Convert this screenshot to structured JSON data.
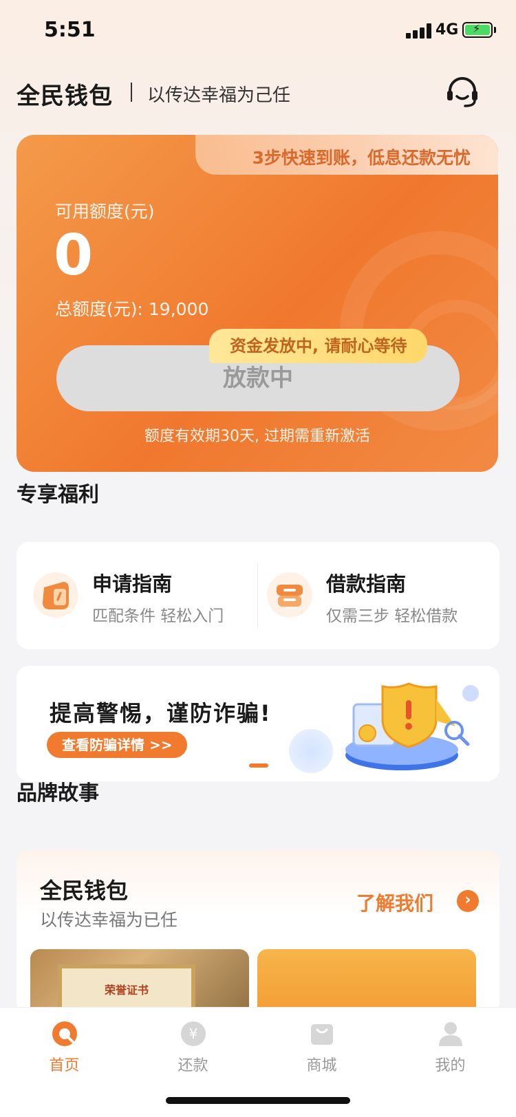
{
  "status_bar": {
    "time": "5:51",
    "network": "4G"
  },
  "header": {
    "brand": "全民钱包",
    "slogan": "以传达幸福为己任",
    "service_icon": "headset-icon"
  },
  "credit_card": {
    "banner_text": "3步快速到账，低息还款无忧",
    "available_label": "可用额度(元)",
    "available_value": "0",
    "total_line": "总额度(元): 19,000",
    "loan_button_label": "放款中",
    "tip_bubble": "资金发放中, 请耐心等待",
    "validity_note": "额度有效期30天, 过期需重新激活"
  },
  "benefits": {
    "title": "专享福利",
    "items": [
      {
        "title": "申请指南",
        "subtitle": "匹配条件 轻松入门",
        "icon": "apply-guide-icon"
      },
      {
        "title": "借款指南",
        "subtitle": "仅需三步 轻松借款",
        "icon": "loan-guide-icon"
      }
    ]
  },
  "fraud_banner": {
    "title": "提高警惕，谨防诈骗!",
    "button": "查看防骗详情 >>",
    "art_icon": "shield-warning-icon"
  },
  "brand_story": {
    "title": "品牌故事",
    "name": "全民钱包",
    "slogan": "以传达幸福为已任",
    "link": "了解我们",
    "certificate_text": "荣誉证书"
  },
  "tabbar": {
    "items": [
      {
        "label": "首页",
        "icon": "home-icon",
        "active": true
      },
      {
        "label": "还款",
        "icon": "yuan-icon",
        "active": false
      },
      {
        "label": "商城",
        "icon": "shopping-bag-icon",
        "active": false
      },
      {
        "label": "我的",
        "icon": "user-icon",
        "active": false
      }
    ]
  },
  "colors": {
    "accent": "#f07a2e",
    "card_gradient_start": "#f49a4a",
    "card_gradient_end": "#f0782e",
    "tip_yellow": "#ffd76a"
  }
}
